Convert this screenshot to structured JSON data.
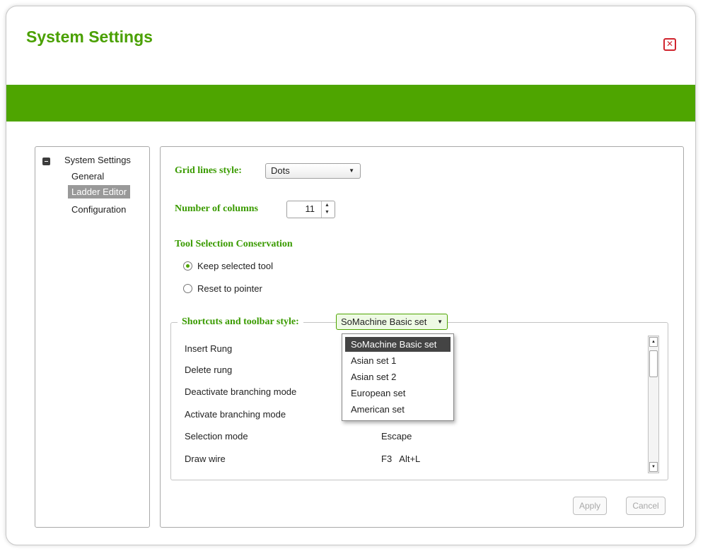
{
  "window": {
    "title": "System Settings",
    "close_glyph": "✕"
  },
  "tree": {
    "root": "System Settings",
    "items": [
      {
        "label": "General"
      },
      {
        "label": "Ladder Editor",
        "selected": true
      },
      {
        "label": "Configuration"
      }
    ]
  },
  "grid": {
    "label": "Grid lines style:",
    "value": "Dots"
  },
  "columns": {
    "label": "Number of columns",
    "value": "11"
  },
  "tool_selection": {
    "heading": "Tool Selection Conservation",
    "options": [
      {
        "label": "Keep selected tool",
        "checked": true
      },
      {
        "label": "Reset to pointer",
        "checked": false
      }
    ]
  },
  "shortcuts": {
    "label": "Shortcuts and toolbar style:",
    "value": "SoMachine Basic set",
    "rows": [
      {
        "action": "Insert Rung",
        "key": ""
      },
      {
        "action": "Delete rung",
        "key": ""
      },
      {
        "action": "Deactivate branching mode",
        "key": ""
      },
      {
        "action": "Activate branching mode",
        "key": ""
      },
      {
        "action": "Selection mode",
        "key": "Escape"
      },
      {
        "action": "Draw wire",
        "key": "F3   Alt+L"
      }
    ],
    "options": [
      "SoMachine Basic set",
      "Asian set 1",
      "Asian set 2",
      "European set",
      "American set"
    ]
  },
  "buttons": {
    "apply": "Apply",
    "cancel": "Cancel"
  },
  "colors": {
    "accent": "#4ea500",
    "title_green": "#4aa000",
    "close_red": "#d0242e"
  }
}
